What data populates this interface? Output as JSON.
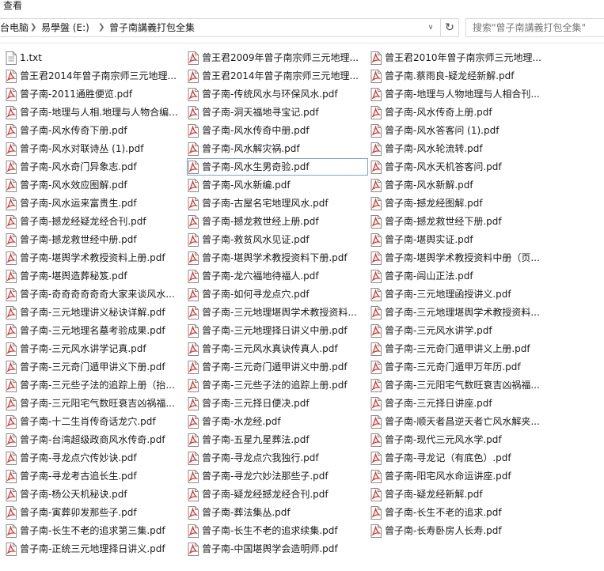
{
  "menubar": {
    "view_label": "查看"
  },
  "address_bar": {
    "crumbs": [
      "台电脑",
      "易學盤 (E:)",
      "曾子南講義打包全集"
    ]
  },
  "search": {
    "placeholder": "搜索\"曾子南講義打包全集\""
  },
  "colors": {
    "pdf_red": "#d9372b",
    "selection_border": "#7aa7d8"
  },
  "icons": {
    "pdf": "pdf-file-icon",
    "txt": "text-file-icon"
  },
  "selected_file": "曾子南-风水生男奇验.pdf",
  "columns": [
    [
      {
        "name": "1.txt",
        "type": "txt"
      },
      {
        "name": "曾王君2014年曾子南宗师三元地理...",
        "type": "pdf"
      },
      {
        "name": "曾子南-2011通胜便览.pdf",
        "type": "pdf"
      },
      {
        "name": "曾子南-地理与人相.地理与人物合编...",
        "type": "pdf"
      },
      {
        "name": "曾子南-风水传奇下册.pdf",
        "type": "pdf"
      },
      {
        "name": "曾子南-风水对联诗丛 (1).pdf",
        "type": "pdf"
      },
      {
        "name": "曾子南-风水奇门异象志.pdf",
        "type": "pdf"
      },
      {
        "name": "曾子南-风水效应图解.pdf",
        "type": "pdf"
      },
      {
        "name": "曾子南-风水运来富贵生.pdf",
        "type": "pdf"
      },
      {
        "name": "曾子南-撼龙经疑龙经合刊.pdf",
        "type": "pdf"
      },
      {
        "name": "曾子南-撼龙救世经中册.pdf",
        "type": "pdf"
      },
      {
        "name": "曾子南-堪舆学术教授资料上册.pdf",
        "type": "pdf"
      },
      {
        "name": "曾子南-堪舆造葬秘笈.pdf",
        "type": "pdf"
      },
      {
        "name": "曾子南-奇奇奇奇奇奇大家来谈风水...",
        "type": "pdf"
      },
      {
        "name": "曾子南-三元地理讲义秘诀详解.pdf",
        "type": "pdf"
      },
      {
        "name": "曾子南-三元地理名墓考验成果.pdf",
        "type": "pdf"
      },
      {
        "name": "曾子南-三元风水讲学记真.pdf",
        "type": "pdf"
      },
      {
        "name": "曾子南-三元奇门遁甲讲义下册.pdf",
        "type": "pdf"
      },
      {
        "name": "曾子南-三元些子法的追踪上册（抬...",
        "type": "pdf"
      },
      {
        "name": "曾子南-三元阳宅气数旺衰吉凶祸福...",
        "type": "pdf"
      },
      {
        "name": "曾子南-十二生肖传奇话龙穴.pdf",
        "type": "pdf"
      },
      {
        "name": "曾子南-台湾超级政商风水传奇.pdf",
        "type": "pdf"
      },
      {
        "name": "曾子南-寻龙点穴传妙诀.pdf",
        "type": "pdf"
      },
      {
        "name": "曾子南-寻龙考古追长生.pdf",
        "type": "pdf"
      },
      {
        "name": "曾子南-杨公天机秘诀.pdf",
        "type": "pdf"
      },
      {
        "name": "曾子南-寅葬卯发那些子.pdf",
        "type": "pdf"
      },
      {
        "name": "曾子南-长生不老的追求第三集.pdf",
        "type": "pdf"
      },
      {
        "name": "曾子南-正统三元地理择日讲义.pdf",
        "type": "pdf"
      }
    ],
    [
      {
        "name": "曾王君2009年曾子南宗师三元地理...",
        "type": "pdf"
      },
      {
        "name": "曾王君2014年曾子南宗师三元地理...",
        "type": "pdf"
      },
      {
        "name": "曾子南-传统风水与环保风水.pdf",
        "type": "pdf"
      },
      {
        "name": "曾子南-洞天福地寻宝记.pdf",
        "type": "pdf"
      },
      {
        "name": "曾子南-风水传奇中册.pdf",
        "type": "pdf"
      },
      {
        "name": "曾子南-风水解灾祸.pdf",
        "type": "pdf"
      },
      {
        "name": "曾子南-风水生男奇验.pdf",
        "type": "pdf"
      },
      {
        "name": "曾子南-风水新编.pdf",
        "type": "pdf"
      },
      {
        "name": "曾子南-古屋名宅地理风水.pdf",
        "type": "pdf"
      },
      {
        "name": "曾子南-撼龙救世经上册.pdf",
        "type": "pdf"
      },
      {
        "name": "曾子南-救贫风水见证.pdf",
        "type": "pdf"
      },
      {
        "name": "曾子南-堪舆学术教授资料下册.pdf",
        "type": "pdf"
      },
      {
        "name": "曾子南-龙穴福地待福人.pdf",
        "type": "pdf"
      },
      {
        "name": "曾子南-如何寻龙点穴.pdf",
        "type": "pdf"
      },
      {
        "name": "曾子南-三元地理堪舆学术教授资料...",
        "type": "pdf"
      },
      {
        "name": "曾子南-三元地理择日讲义中册.pdf",
        "type": "pdf"
      },
      {
        "name": "曾子南-三元风水真诀传真人.pdf",
        "type": "pdf"
      },
      {
        "name": "曾子南-三元奇门遁甲讲义中册.pdf",
        "type": "pdf"
      },
      {
        "name": "曾子南-三元些子法的追踪上册.pdf",
        "type": "pdf"
      },
      {
        "name": "曾子南-三元择日便决.pdf",
        "type": "pdf"
      },
      {
        "name": "曾子南-水龙经.pdf",
        "type": "pdf"
      },
      {
        "name": "曾子南-五星九星葬法.pdf",
        "type": "pdf"
      },
      {
        "name": "曾子南-寻龙点穴我独行.pdf",
        "type": "pdf"
      },
      {
        "name": "曾子南-寻龙穴妙法那些子.pdf",
        "type": "pdf"
      },
      {
        "name": "曾子南-疑龙经撼龙经合刊.pdf",
        "type": "pdf"
      },
      {
        "name": "曾子南-葬法集丛.pdf",
        "type": "pdf"
      },
      {
        "name": "曾子南-长生不老的追求续集.pdf",
        "type": "pdf"
      },
      {
        "name": "曾子南-中国堪舆学会造明师.pdf",
        "type": "pdf"
      }
    ],
    [
      {
        "name": "曾王君2010年曾子南宗师三元地理...",
        "type": "pdf"
      },
      {
        "name": "曾子南.蔡雨良-疑龙经新解.pdf",
        "type": "pdf"
      },
      {
        "name": "曾子南-地理与人物地理与人相合刊...",
        "type": "pdf"
      },
      {
        "name": "曾子南-风水传奇上册.pdf",
        "type": "pdf"
      },
      {
        "name": "曾子南-风水答客问 (1).pdf",
        "type": "pdf"
      },
      {
        "name": "曾子南-风水轮流转.pdf",
        "type": "pdf"
      },
      {
        "name": "曾子南-风水天机答客问.pdf",
        "type": "pdf"
      },
      {
        "name": "曾子南-风水新解.pdf",
        "type": "pdf"
      },
      {
        "name": "曾子南-撼龙经图解.pdf",
        "type": "pdf"
      },
      {
        "name": "曾子南-撼龙救世经下册.pdf",
        "type": "pdf"
      },
      {
        "name": "曾子南-堪舆实证.pdf",
        "type": "pdf"
      },
      {
        "name": "曾子南-堪舆学术教授资料中册（页...",
        "type": "pdf"
      },
      {
        "name": "曾子南-闾山正法.pdf",
        "type": "pdf"
      },
      {
        "name": "曾子南-三元地理函授讲义.pdf",
        "type": "pdf"
      },
      {
        "name": "曾子南-三元地理堪舆学术教授资料...",
        "type": "pdf"
      },
      {
        "name": "曾子南-三元风水讲学.pdf",
        "type": "pdf"
      },
      {
        "name": "曾子南-三元奇门遁甲讲义上册.pdf",
        "type": "pdf"
      },
      {
        "name": "曾子南-三元奇门遁甲万年历.pdf",
        "type": "pdf"
      },
      {
        "name": "曾子南-三元阳宅气数旺衰吉凶祸福...",
        "type": "pdf"
      },
      {
        "name": "曾子南-三元择日讲座.pdf",
        "type": "pdf"
      },
      {
        "name": "曾子南-顺天者昌逆天者亡风水解夹...",
        "type": "pdf"
      },
      {
        "name": "曾子南-现代三元风水学.pdf",
        "type": "pdf"
      },
      {
        "name": "曾子南-寻龙记（有底色）.pdf",
        "type": "pdf"
      },
      {
        "name": "曾子南-阳宅风水命运讲座.pdf",
        "type": "pdf"
      },
      {
        "name": "曾子南-疑龙经新解.pdf",
        "type": "pdf"
      },
      {
        "name": "曾子南-长生不老的追求.pdf",
        "type": "pdf"
      },
      {
        "name": "曾子南-长寿卧房人长寿.pdf",
        "type": "pdf"
      }
    ]
  ]
}
